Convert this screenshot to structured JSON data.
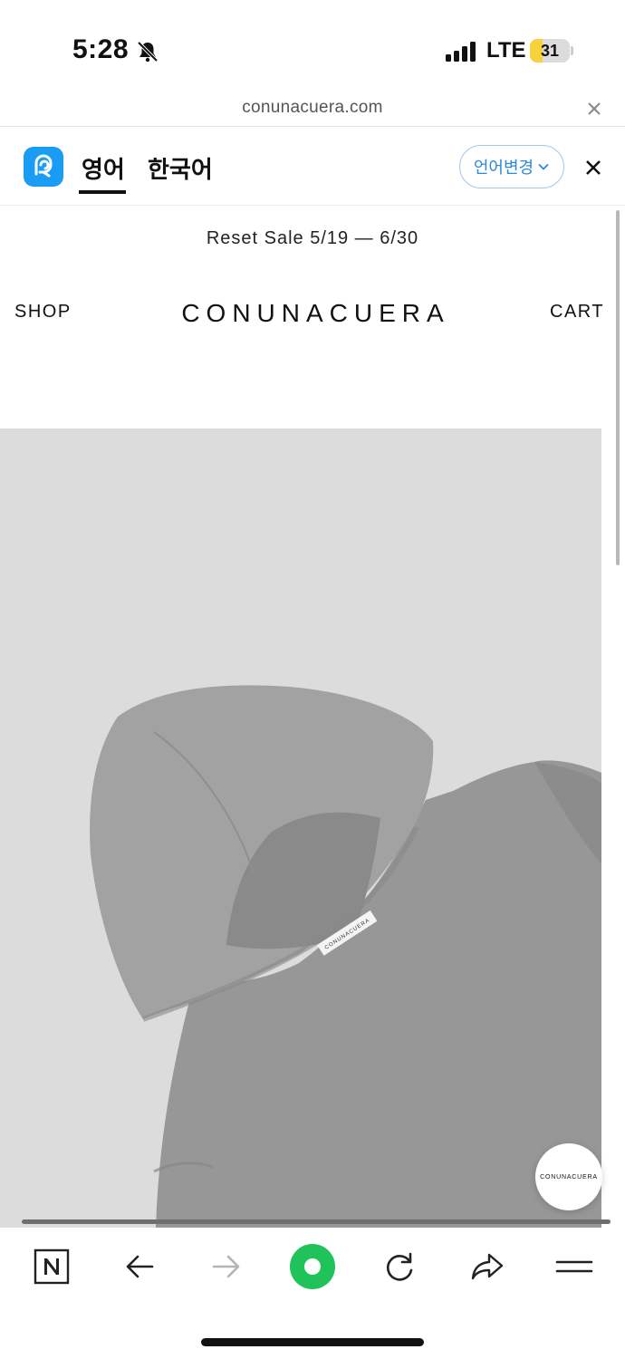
{
  "status_bar": {
    "time": "5:28",
    "network": "LTE",
    "battery": "31",
    "battery_level": 0.31,
    "icons": [
      "bell-slash-icon",
      "signal-icon",
      "battery-icon"
    ]
  },
  "browser": {
    "url": "conunacuera.com",
    "toolbar_icons": [
      "naver-icon",
      "back-arrow-icon",
      "forward-arrow-icon",
      "green-dot-icon",
      "refresh-icon",
      "share-icon",
      "menu-icon"
    ]
  },
  "translate": {
    "source_lang": "영어",
    "target_lang": "한국어",
    "change_label": "언어변경",
    "accent": "#2e8ad6"
  },
  "site": {
    "promo": "Reset Sale 5/19 — 6/30",
    "nav_left": "SHOP",
    "nav_right": "CART",
    "logo": "CONUNACUERA",
    "garment_label": "CONUNACUERA",
    "float_logo": "CONUNACUERA"
  },
  "colors": {
    "hero_background": "#dcdcdc",
    "hoodie": "#9a9a9a",
    "green_button": "#20c35a"
  }
}
